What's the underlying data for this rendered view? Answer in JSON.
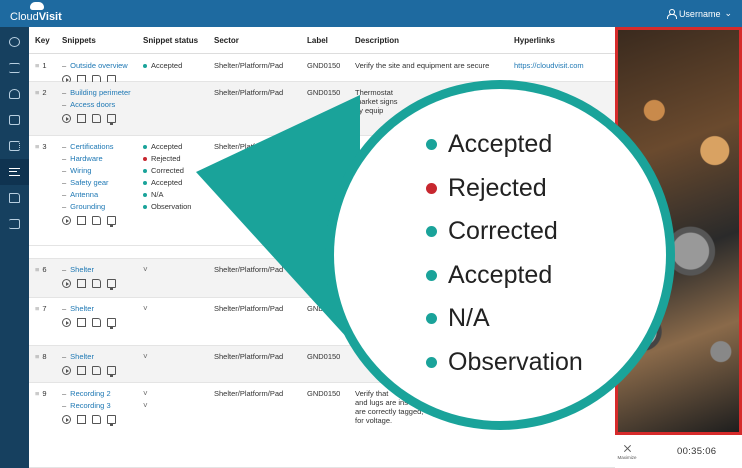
{
  "app": {
    "logo_prefix": "Cloud",
    "logo_suffix": "Visit",
    "username": "Username"
  },
  "sidebar": {
    "icons": [
      "gear-icon",
      "checklist-icon",
      "user-icon",
      "chat-icon",
      "edit-icon",
      "list-icon",
      "folder-icon",
      "logout-icon"
    ]
  },
  "table": {
    "headers": {
      "key": "Key",
      "snippets": "Snippets",
      "status": "Snippet status",
      "sector": "Sector",
      "label": "Label",
      "description": "Description",
      "hyperlinks": "Hyperlinks"
    },
    "rows": [
      {
        "key": "1",
        "snippets": [
          "Outside overview"
        ],
        "status": [
          {
            "text": "Accepted",
            "color": "#1aa39a"
          }
        ],
        "sector": "Shelter/Platform/Pad",
        "label": "GND0150",
        "description": [
          "Verify the site and equipment are secure"
        ],
        "hyperlink": "https://cloudvisit.com"
      },
      {
        "key": "2",
        "snippets": [
          "Building perimeter",
          "Access doors"
        ],
        "status": [],
        "sector": "Shelter/Platform/Pad",
        "label": "GND0150",
        "description": [
          "Thermostat",
          "market signs",
          "by equip"
        ],
        "hyperlink": ""
      },
      {
        "key": "3",
        "snippets": [
          "Certifications",
          "Hardware",
          "Wiring",
          "Safety gear",
          "Antenna",
          "Grounding"
        ],
        "status": [
          {
            "text": "Accepted",
            "color": "#1aa39a"
          },
          {
            "text": "Rejected",
            "color": "#c7272f"
          },
          {
            "text": "Corrected",
            "color": "#1aa39a"
          },
          {
            "text": "Accepted",
            "color": "#1aa39a"
          },
          {
            "text": "N/A",
            "color": "#1aa39a"
          },
          {
            "text": "Observation",
            "color": "#1aa39a"
          }
        ],
        "sector": "Shelter/Platform/Pad",
        "label": "GND0150",
        "description": [],
        "hyperlink": ""
      },
      {
        "key": "6",
        "snippets": [
          "Shelter"
        ],
        "status": [],
        "sector": "Shelter/Platform/Pad",
        "label": "GND",
        "description": [],
        "hyperlink": ""
      },
      {
        "key": "7",
        "snippets": [
          "Shelter"
        ],
        "status": [],
        "sector": "Shelter/Platform/Pad",
        "label": "GND",
        "description": [],
        "hyperlink": ""
      },
      {
        "key": "8",
        "snippets": [
          "Shelter"
        ],
        "status": [],
        "sector": "Shelter/Platform/Pad",
        "label": "GND0150",
        "description": [],
        "hyperlink": ""
      },
      {
        "key": "9",
        "snippets": [
          "Recording 2",
          "Recording 3"
        ],
        "status": [],
        "sector": "Shelter/Platform/Pad",
        "label": "GND0150",
        "description": [
          "Verify that",
          "and lugs are ins",
          "are correctly tagged,",
          "for voltage."
        ],
        "hyperlink": ""
      }
    ]
  },
  "zoom": {
    "items": [
      {
        "text": "Accepted",
        "color": "#1aa39a"
      },
      {
        "text": "Rejected",
        "color": "#c7272f"
      },
      {
        "text": "Corrected",
        "color": "#1aa39a"
      },
      {
        "text": "Accepted",
        "color": "#1aa39a"
      },
      {
        "text": "N/A",
        "color": "#1aa39a"
      },
      {
        "text": "Observation",
        "color": "#1aa39a"
      }
    ]
  },
  "video": {
    "maximize_label": "Maximize",
    "timer": "00:35:06"
  },
  "colors": {
    "topbar": "#1e6aa0",
    "sidebar": "#16405f",
    "accent_teal": "#1aa39a",
    "rejected_red": "#c7272f",
    "video_border": "#d62b2b"
  }
}
